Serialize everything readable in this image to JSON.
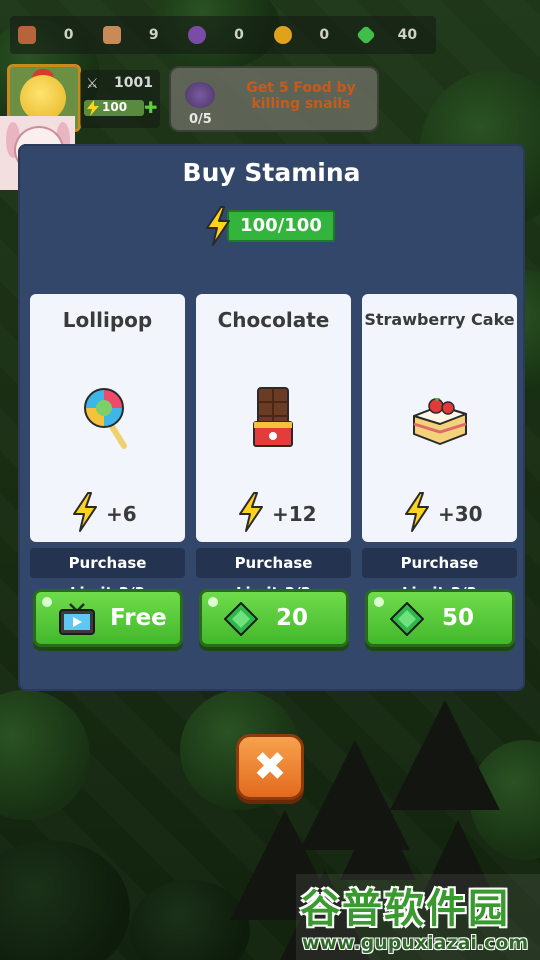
{
  "resources": [
    {
      "icon": "meat-icon",
      "value": "0",
      "color": "#b8643a"
    },
    {
      "icon": "drumstick-icon",
      "value": "9",
      "color": "#c98a5a"
    },
    {
      "icon": "potion-icon",
      "value": "0",
      "color": "#7b4ba8"
    },
    {
      "icon": "coin-plus-icon",
      "value": "0",
      "color": "#e0a21c"
    },
    {
      "icon": "gem-icon",
      "value": "40",
      "color": "#3fbf4a"
    }
  ],
  "player": {
    "power": "1001",
    "stamina": "100"
  },
  "quest": {
    "progress": "0/5",
    "text": "Get 5 Food by killing snails"
  },
  "modal": {
    "title": "Buy Stamina",
    "stamina": "100/100",
    "items": [
      {
        "name": "Lollipop",
        "gain": "+6",
        "limit": "Purchase Limit:3/3",
        "price": "Free",
        "price_icon": "tv-icon"
      },
      {
        "name": "Chocolate",
        "gain": "+12",
        "limit": "Purchase Limit:3/3",
        "price": "20",
        "price_icon": "gem-icon"
      },
      {
        "name": "Strawberry Cake",
        "gain": "+30",
        "limit": "Purchase Limit:3/3",
        "price": "50",
        "price_icon": "gem-icon"
      }
    ]
  },
  "colors": {
    "modal_bg": "#33476b",
    "button_green": "#4fc235",
    "close_orange": "#ee8532",
    "stamina_green": "#33b53d"
  },
  "watermark": {
    "cn": "谷普软件园",
    "url": "www.gupuxiazai.com"
  }
}
